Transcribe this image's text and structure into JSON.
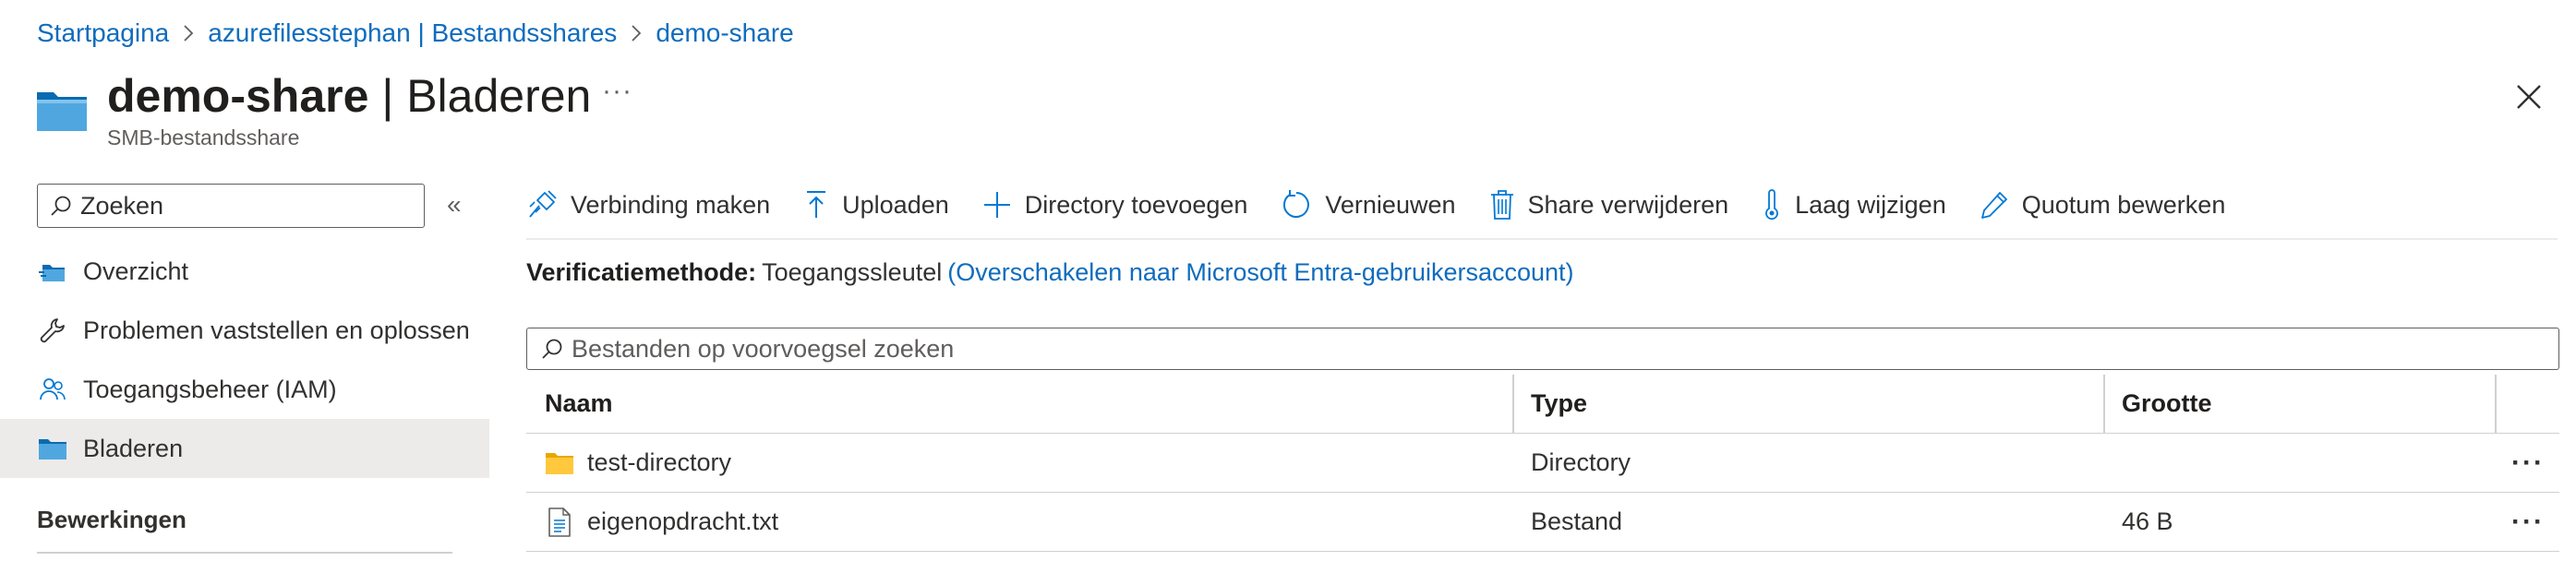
{
  "breadcrumb": {
    "items": [
      "Startpagina",
      "azurefilesstephan | Bestandsshares",
      "demo-share"
    ]
  },
  "header": {
    "title_bold": "demo-share",
    "title_rest": " | Bladeren",
    "more": "···",
    "subtitle": "SMB-bestandsshare",
    "icon": "folder-share-icon"
  },
  "sidebar": {
    "search_placeholder": "Zoeken",
    "collapse": "«",
    "items": [
      {
        "label": "Overzicht",
        "icon": "overview-icon"
      },
      {
        "label": "Problemen vaststellen en oplossen",
        "icon": "wrench-icon"
      },
      {
        "label": "Toegangsbeheer (IAM)",
        "icon": "people-icon"
      },
      {
        "label": "Bladeren",
        "icon": "folder-icon",
        "active": true
      }
    ],
    "section": "Bewerkingen"
  },
  "toolbar": {
    "connect": "Verbinding maken",
    "upload": "Uploaden",
    "add_dir": "Directory toevoegen",
    "refresh": "Vernieuwen",
    "delete": "Share verwijderen",
    "tier": "Laag wijzigen",
    "quota": "Quotum bewerken"
  },
  "verification": {
    "label": "Verificatiemethode:",
    "value": "Toegangssleutel",
    "link": "(Overschakelen naar Microsoft Entra-gebruikersaccount)"
  },
  "file_search": {
    "placeholder": "Bestanden op voorvoegsel zoeken"
  },
  "table": {
    "columns": [
      "Naam",
      "Type",
      "Grootte"
    ],
    "rows": [
      {
        "name": "test-directory",
        "type": "Directory",
        "size": "",
        "icon": "folder-icon",
        "more": "···"
      },
      {
        "name": "eigenopdracht.txt",
        "type": "Bestand",
        "size": "46 B",
        "icon": "file-icon",
        "more": "···"
      }
    ]
  },
  "colors": {
    "link": "#0f6cbd",
    "active_nav": "#edebe9",
    "icon_blue": "#0078d4",
    "folder_yellow": "#ffb900"
  }
}
